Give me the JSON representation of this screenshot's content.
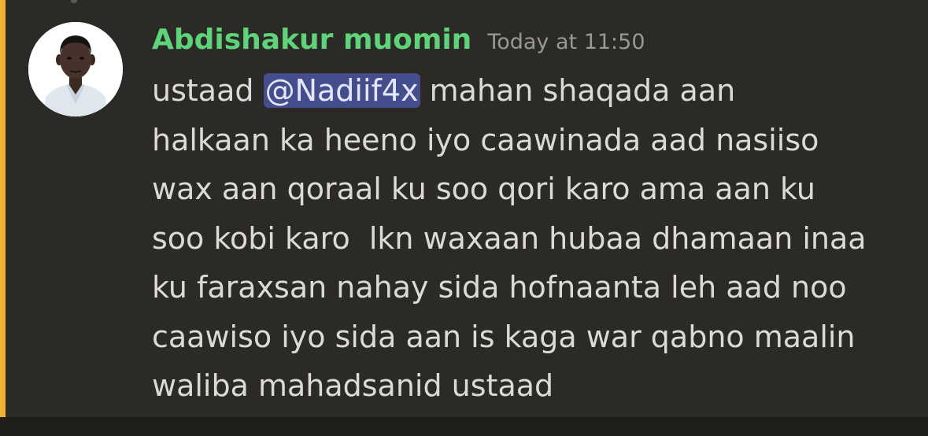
{
  "message": {
    "author": "Abdishakur muomin",
    "timestamp": "Today at 11:50",
    "line1_before": "ustaad ",
    "mention": "@Nadiif4x",
    "line1_after": " mahan shaqada aan",
    "lines": [
      "halkaan ka heeno iyo caawinada aad nasiiso",
      "wax aan qoraal ku soo qori karo ama aan ku",
      "soo kobi karo  lkn waxaan hubaa dhamaan inaa",
      "ku faraxsan nahay sida hofnaanta leh aad noo",
      "caawiso iyo sida aan is kaga war qabno maalin",
      "waliba mahadsanid ustaad"
    ]
  },
  "colors": {
    "background": "#2c2a26",
    "highlight_bar": "#f0b232",
    "username": "#5ed37a",
    "timestamp": "#9a9893",
    "text": "#dcdad5",
    "mention_bg": "#454e8c"
  }
}
